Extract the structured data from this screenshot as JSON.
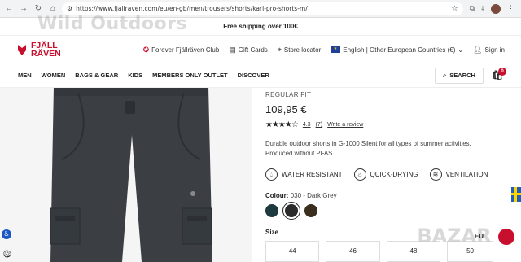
{
  "browser": {
    "url": "https://www.fjallraven.com/eu/en-gb/men/trousers/shorts/karl-pro-shorts-m/"
  },
  "promo": {
    "text": "Free shipping over 100€",
    "watermark": "Wild Outdoors"
  },
  "header": {
    "logo_line1": "FJÄLL",
    "logo_line2": "RÄVEN",
    "club": "Forever Fjällräven Club",
    "gift_cards": "Gift Cards",
    "store_locator": "Store locator",
    "language": "English | Other European Countries (€)",
    "sign_in": "Sign in"
  },
  "nav": {
    "items": [
      "MEN",
      "WOMEN",
      "BAGS & GEAR",
      "KIDS",
      "MEMBERS ONLY OUTLET",
      "DISCOVER"
    ],
    "search": "SEARCH",
    "cart_count": "0"
  },
  "product": {
    "fit": "REGULAR FIT",
    "price": "109,95 €",
    "rating_value": "4.3",
    "rating_count": "(7)",
    "write_review": "Write a review",
    "stars": 4.3,
    "description": "Durable outdoor shorts in G-1000 Silent for all types of summer activities. Produced without PFAS.",
    "features": [
      "WATER RESISTANT",
      "QUICK-DRYING",
      "VENTILATION"
    ],
    "colour_label": "Colour:",
    "colour_value": "030 - Dark Grey",
    "swatches": [
      "#1d3a3f",
      "#2b2b2b",
      "#3a2e1d"
    ],
    "selected_swatch": 1,
    "size_label": "Size",
    "sizes": [
      "44",
      "46",
      "48",
      "50"
    ]
  },
  "overlay": {
    "brand_watermark": "BAZAR",
    "size_overlay": "EU"
  }
}
